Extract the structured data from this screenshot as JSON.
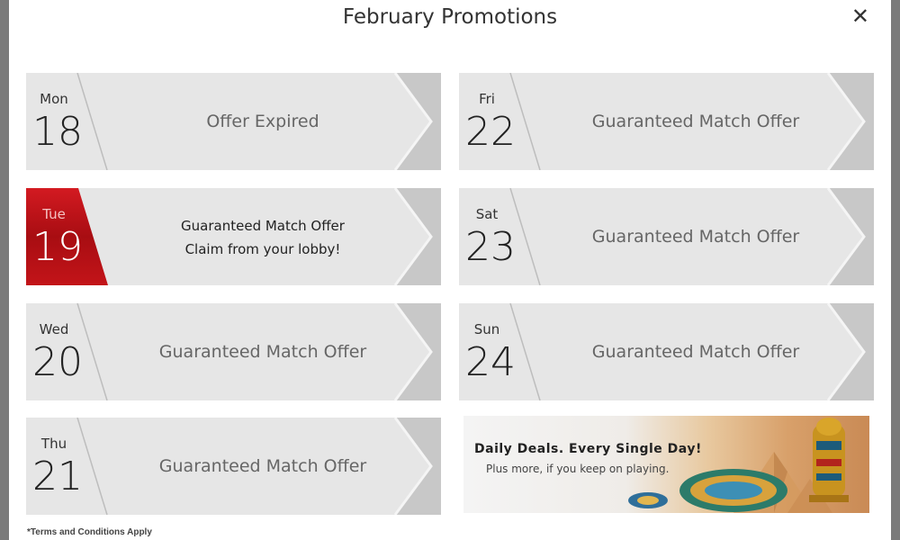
{
  "modal": {
    "title": "February Promotions",
    "close_symbol": "✕"
  },
  "promotions": [
    {
      "day": "Mon",
      "date": "18",
      "text": "Offer Expired"
    },
    {
      "day": "Fri",
      "date": "22",
      "text": "Guaranteed Match Offer"
    },
    {
      "day": "Tue",
      "date": "19",
      "line1": "Guaranteed Match Offer",
      "line2": "Claim from your lobby!"
    },
    {
      "day": "Sat",
      "date": "23",
      "text": "Guaranteed Match Offer"
    },
    {
      "day": "Wed",
      "date": "20",
      "text": "Guaranteed Match Offer"
    },
    {
      "day": "Sun",
      "date": "24",
      "text": "Guaranteed Match Offer"
    },
    {
      "day": "Thu",
      "date": "21",
      "text": "Guaranteed Match Offer"
    }
  ],
  "banner": {
    "title": "Daily Deals. Every Single Day!",
    "subtitle": "Plus more, if you keep on playing."
  },
  "terms": "*Terms and Conditions Apply",
  "colors": {
    "active": "#c0141b",
    "card": "#e6e6e6",
    "chevron": "#c8c8c8"
  }
}
